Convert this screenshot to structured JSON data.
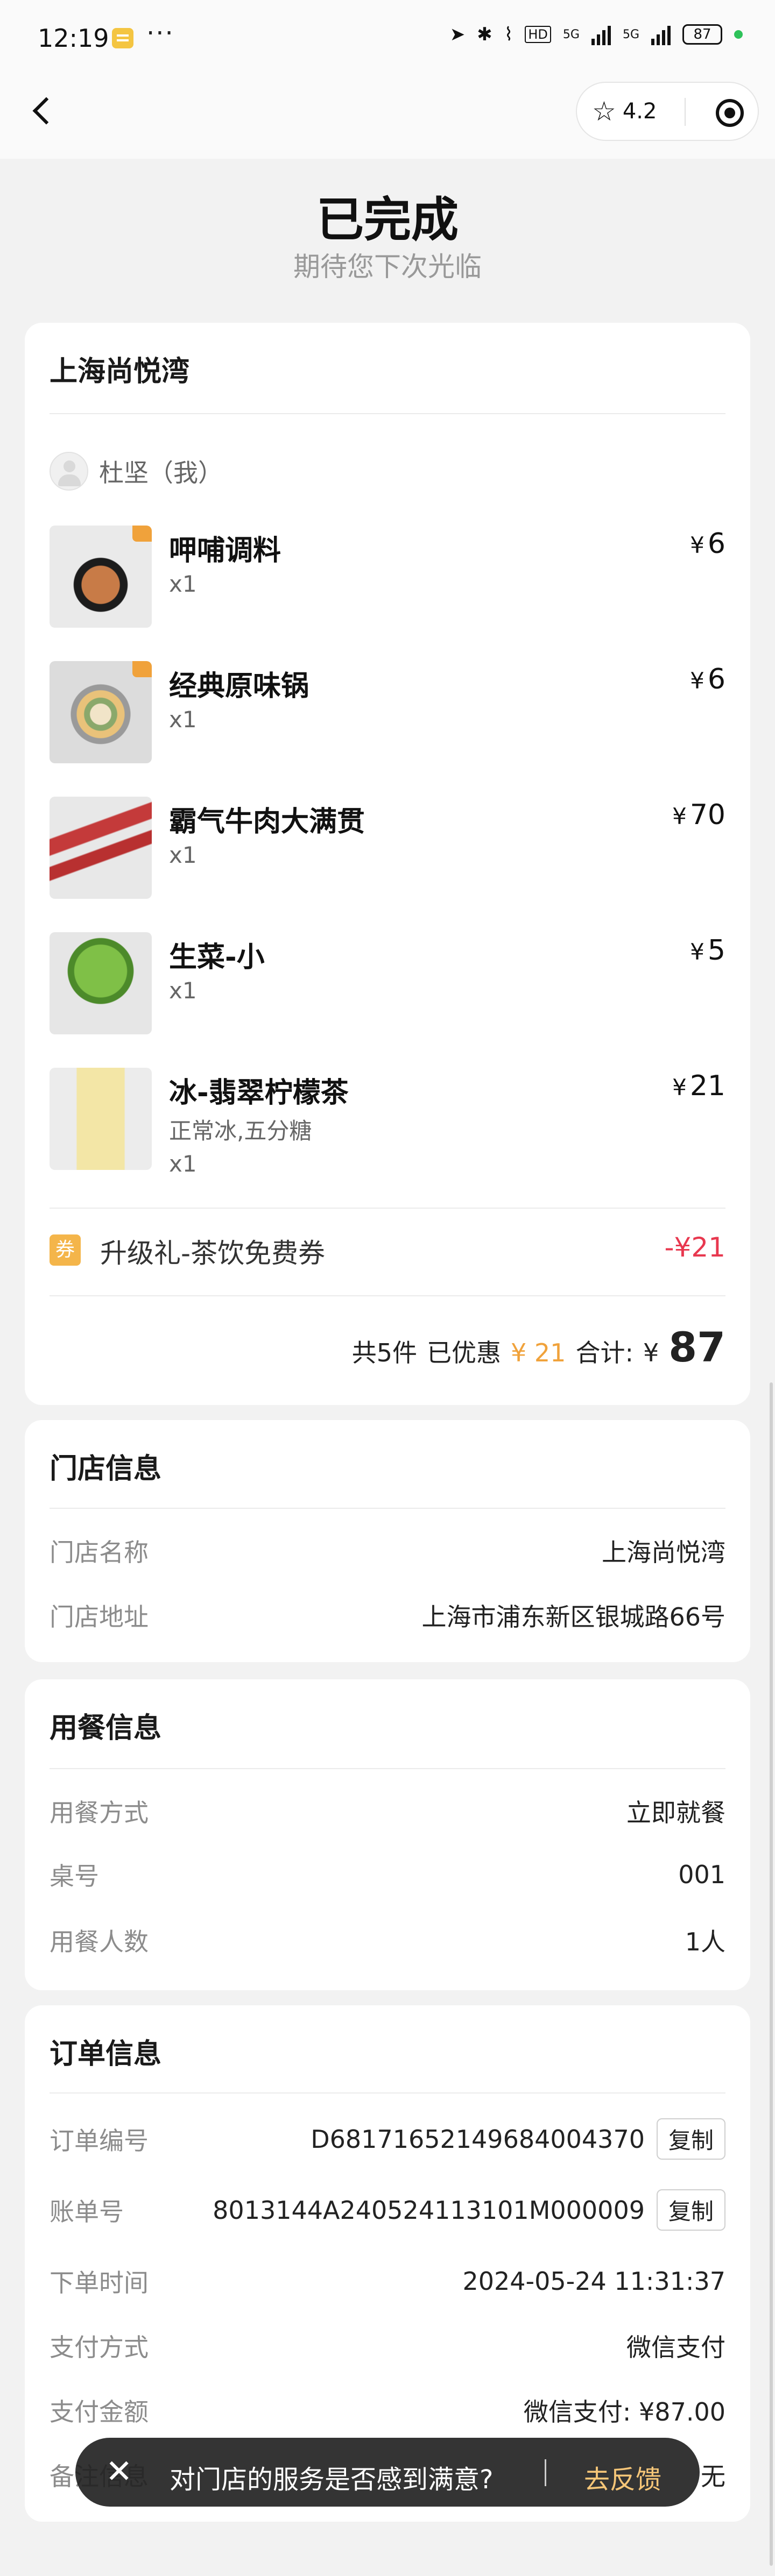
{
  "status_bar": {
    "time": "12:19",
    "more": "···",
    "network_1": "5G",
    "network_2": "5G",
    "battery": "87"
  },
  "header": {
    "rating": "4.2"
  },
  "page": {
    "title": "已完成",
    "subtitle": "期待您下次光临"
  },
  "order_card": {
    "store_name": "上海尚悦湾",
    "user": "杜坚（我）",
    "items": [
      {
        "name": "呷哺调料",
        "spec": "",
        "qty": "x1",
        "currency": "¥",
        "price": "6"
      },
      {
        "name": "经典原味锅",
        "spec": "",
        "qty": "x1",
        "currency": "¥",
        "price": "6"
      },
      {
        "name": "霸气牛肉大满贯",
        "spec": "",
        "qty": "x1",
        "currency": "¥",
        "price": "70"
      },
      {
        "name": "生菜-小",
        "spec": "",
        "qty": "x1",
        "currency": "¥",
        "price": "5"
      },
      {
        "name": "冰-翡翠柠檬茶",
        "spec": "正常冰,五分糖",
        "qty": "x1",
        "currency": "¥",
        "price": "21"
      }
    ],
    "coupon": {
      "icon_text": "券",
      "name": "升级礼-茶饮免费券",
      "value": "-¥21"
    },
    "summary": {
      "count": "共5件",
      "discount_label": "已优惠",
      "discount": "¥ 21",
      "total_label": "合计:",
      "currency": "¥",
      "total": "87"
    }
  },
  "store_info": {
    "title": "门店信息",
    "rows": [
      {
        "k": "门店名称",
        "v": "上海尚悦湾"
      },
      {
        "k": "门店地址",
        "v": "上海市浦东新区银城路66号"
      }
    ]
  },
  "dining_info": {
    "title": "用餐信息",
    "rows": [
      {
        "k": "用餐方式",
        "v": "立即就餐"
      },
      {
        "k": "桌号",
        "v": "001"
      },
      {
        "k": "用餐人数",
        "v": "1人"
      }
    ]
  },
  "order_info": {
    "title": "订单信息",
    "copy_label": "复制",
    "rows": [
      {
        "k": "订单编号",
        "v": "D68171652149684004370"
      },
      {
        "k": "账单号",
        "v": "8013144A240524113101M000009"
      },
      {
        "k": "下单时间",
        "v": "2024-05-24 11:31:37"
      },
      {
        "k": "支付方式",
        "v": "微信支付"
      },
      {
        "k": "支付金额",
        "v": "微信支付: ¥87.00"
      },
      {
        "k": "备注信息",
        "v": "无"
      }
    ]
  },
  "toast": {
    "message": "对门店的服务是否感到满意?",
    "action": "去反馈"
  },
  "colors": {
    "accent_orange": "#f0a23b",
    "coupon_red": "#e8384f",
    "background": "#f2f2f2"
  }
}
